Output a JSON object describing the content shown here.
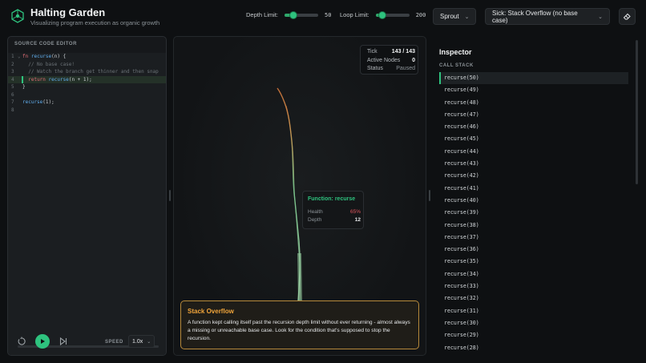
{
  "app": {
    "title": "Halting Garden",
    "subtitle": "Visualizing program execution as organic growth"
  },
  "controls": {
    "depth_limit": {
      "label": "Depth Limit:",
      "value": "50",
      "fraction": 0.25
    },
    "loop_limit": {
      "label": "Loop Limit:",
      "value": "200",
      "fraction": 0.2
    },
    "mode": {
      "selected": "Sprout"
    },
    "scenario": {
      "selected": "Sick: Stack Overflow (no base case)"
    }
  },
  "editor": {
    "header": "SOURCE CODE EDITOR",
    "lines": [
      {
        "n": "1",
        "fold": "⌄",
        "tokens": [
          {
            "t": "fn",
            "c": "kw"
          },
          {
            "t": " ",
            "c": "pl"
          },
          {
            "t": "recurse",
            "c": "fn"
          },
          {
            "t": "(n) {",
            "c": "pl"
          }
        ]
      },
      {
        "n": "2",
        "fold": "",
        "tokens": [
          {
            "t": "  // No base case!",
            "c": "cm"
          }
        ]
      },
      {
        "n": "3",
        "fold": "",
        "tokens": [
          {
            "t": "  // Watch the branch get thinner and then snap",
            "c": "cm"
          }
        ]
      },
      {
        "n": "4",
        "fold": "",
        "active": true,
        "tokens": [
          {
            "t": "  ",
            "c": "pl"
          },
          {
            "t": "return",
            "c": "kw"
          },
          {
            "t": " ",
            "c": "pl"
          },
          {
            "t": "recurse",
            "c": "fn"
          },
          {
            "t": "(n + 1);",
            "c": "pl"
          }
        ]
      },
      {
        "n": "5",
        "fold": "",
        "tokens": [
          {
            "t": "}",
            "c": "pl"
          }
        ]
      },
      {
        "n": "6",
        "fold": "",
        "tokens": []
      },
      {
        "n": "7",
        "fold": "",
        "tokens": [
          {
            "t": "recurse",
            "c": "fn"
          },
          {
            "t": "(1);",
            "c": "pl"
          }
        ]
      },
      {
        "n": "8",
        "fold": "",
        "tokens": []
      }
    ],
    "speed_label": "SPEED",
    "speed_value": "1.0x"
  },
  "canvas": {
    "stats": {
      "tick_label": "Tick",
      "tick_value": "143 / 143",
      "nodes_label": "Active Nodes",
      "nodes_value": "0",
      "status_label": "Status",
      "status_value": "Paused"
    },
    "tooltip": {
      "title": "Function: recurse",
      "health_label": "Health",
      "health_value": "65%",
      "depth_label": "Depth",
      "depth_value": "12"
    },
    "alert": {
      "title": "Stack Overflow",
      "body": "A function kept calling itself past the recursion depth limit without ever returning - almost always a missing or unreachable base case. Look for the condition that's supposed to stop the recursion."
    }
  },
  "inspector": {
    "title": "Inspector",
    "section": "CALL STACK",
    "stack": [
      "recurse(50)",
      "recurse(49)",
      "recurse(48)",
      "recurse(47)",
      "recurse(46)",
      "recurse(45)",
      "recurse(44)",
      "recurse(43)",
      "recurse(42)",
      "recurse(41)",
      "recurse(40)",
      "recurse(39)",
      "recurse(38)",
      "recurse(37)",
      "recurse(36)",
      "recurse(35)",
      "recurse(34)",
      "recurse(33)",
      "recurse(32)",
      "recurse(31)",
      "recurse(30)",
      "recurse(29)",
      "recurse(28)"
    ]
  },
  "colors": {
    "accent": "#2ec27e",
    "warning": "#f0a43a",
    "danger": "#e0555d",
    "stem_healthy": "#8fd9a0",
    "stem_sick": "#d9783a"
  }
}
